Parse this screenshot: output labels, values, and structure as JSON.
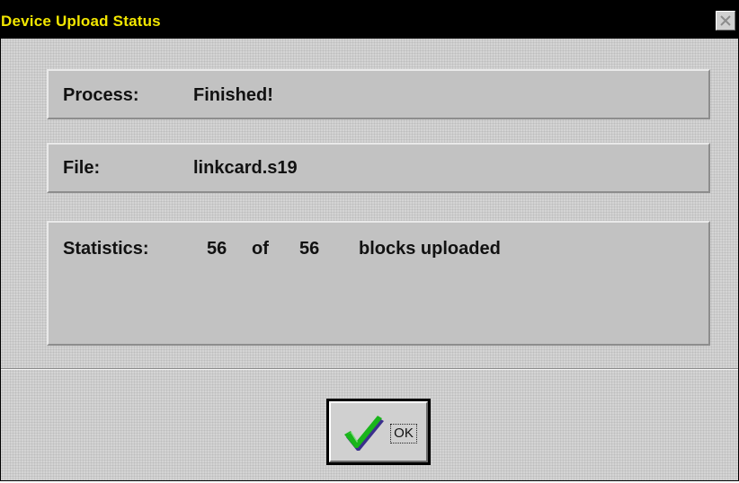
{
  "window": {
    "title": "Device Upload Status",
    "close_icon": "close-icon"
  },
  "process": {
    "label": "Process:",
    "value": "Finished!"
  },
  "file": {
    "label": "File:",
    "value": "linkcard.s19"
  },
  "statistics": {
    "label": "Statistics:",
    "uploaded": "56",
    "of_text": "of",
    "total": "56",
    "suffix": "blocks uploaded"
  },
  "ok_button": {
    "label": "OK",
    "icon": "checkmark-icon"
  },
  "colors": {
    "title_bar": "#000000",
    "title_text": "#f2e600",
    "check_green": "#19b51b",
    "check_shadow": "#3b2f8c"
  }
}
